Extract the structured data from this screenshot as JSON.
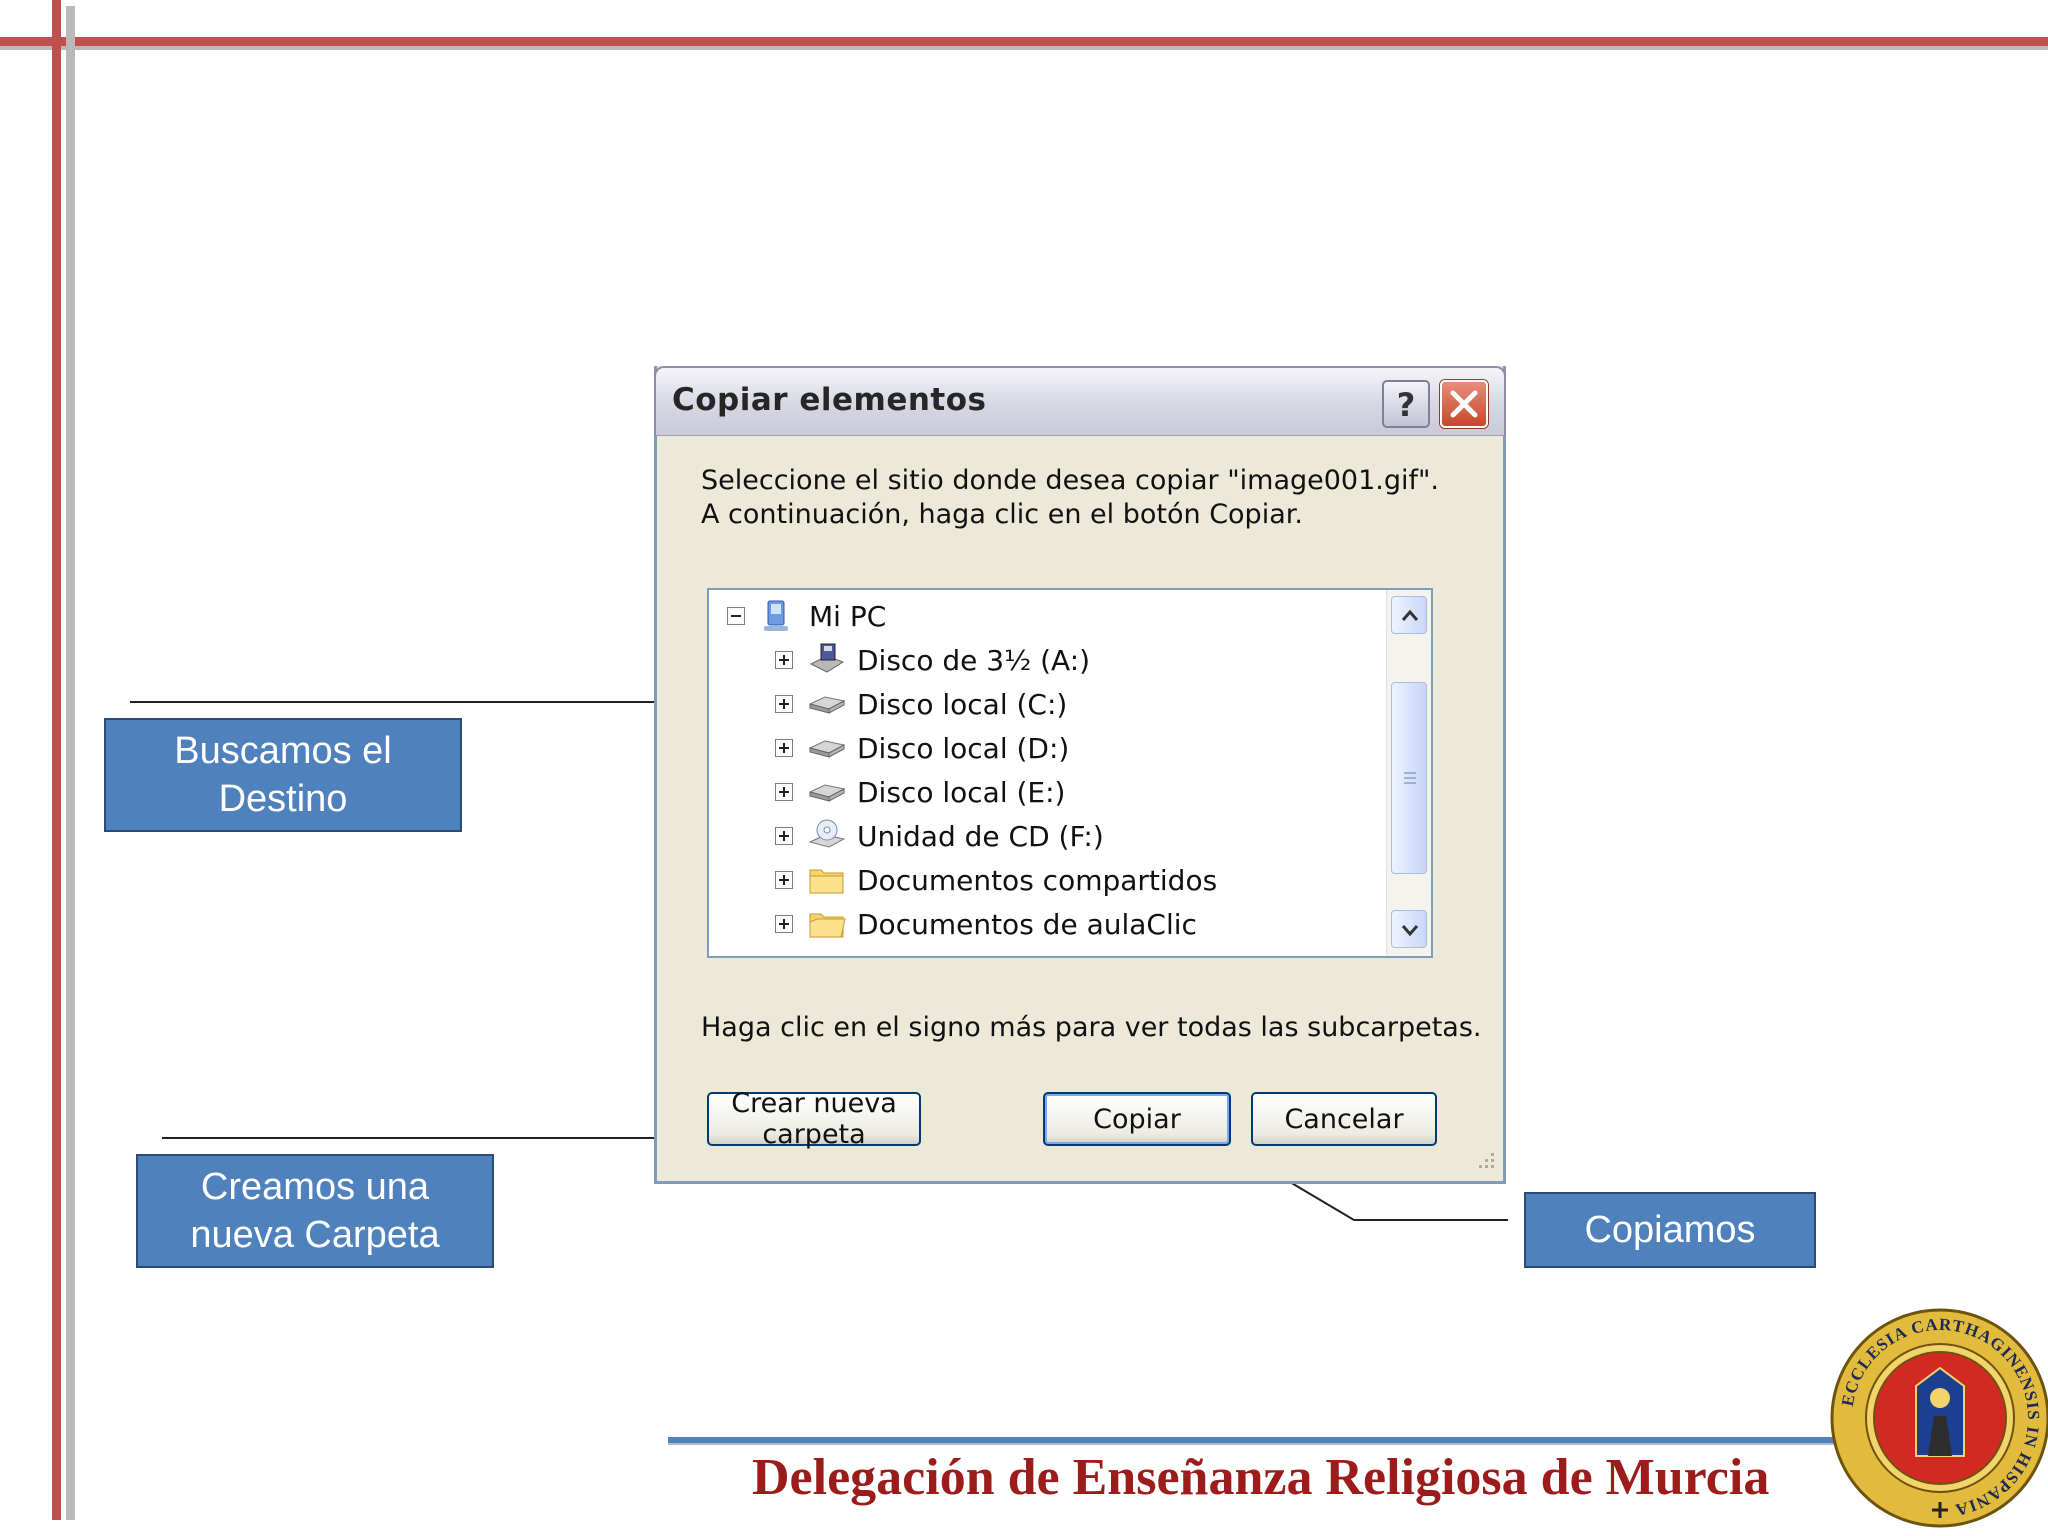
{
  "dialog": {
    "title": "Copiar elementos",
    "help_label": "?",
    "prompt": "Seleccione el sitio donde desea copiar \"image001.gif\". A continuación, haga clic en el botón Copiar.",
    "hint": "Haga clic en el signo más para ver todas las subcarpetas.",
    "tree": {
      "root": {
        "label": "Mi PC",
        "icon": "computer-icon"
      },
      "items": [
        {
          "label": "Disco de 3½ (A:)",
          "icon": "floppy-drive-icon"
        },
        {
          "label": "Disco local (C:)",
          "icon": "hard-drive-icon"
        },
        {
          "label": "Disco local (D:)",
          "icon": "hard-drive-icon"
        },
        {
          "label": "Disco local (E:)",
          "icon": "hard-drive-icon"
        },
        {
          "label": "Unidad de CD (F:)",
          "icon": "cd-drive-icon"
        },
        {
          "label": "Documentos compartidos",
          "icon": "folder-icon"
        },
        {
          "label": "Documentos de aulaClic",
          "icon": "folder-icon"
        }
      ]
    },
    "buttons": {
      "new_folder": "Crear nueva carpeta",
      "copy": "Copiar",
      "cancel": "Cancelar"
    }
  },
  "callouts": {
    "destino": [
      "Buscamos el",
      "Destino"
    ],
    "carpeta": [
      "Creamos una",
      "nueva Carpeta"
    ],
    "copiamos": "Copiamos"
  },
  "footer": {
    "text": "Delegación de Enseñanza Religiosa de Murcia",
    "seal_text": "ECCLESIA CARTHAGINENSIS IN HISPANIA"
  },
  "colors": {
    "accent_red": "#c0504d",
    "callout_blue": "#4f81bd",
    "footer_text": "#9c1c1c"
  }
}
